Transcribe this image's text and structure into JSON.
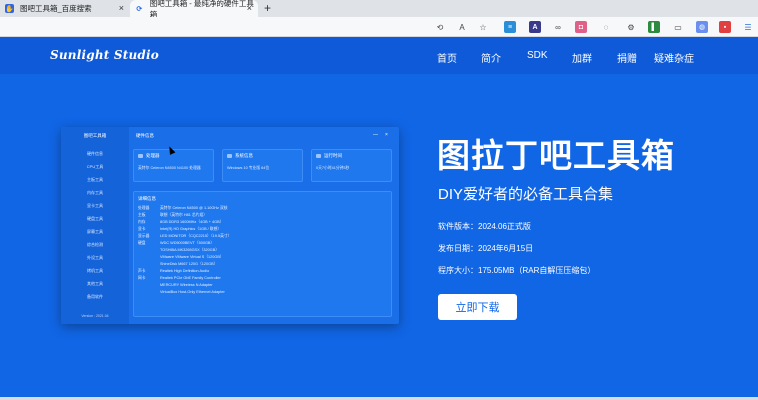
{
  "browser": {
    "tabs": [
      {
        "title": "图吧工具箱_百度搜索",
        "icon": "baidu-icon"
      },
      {
        "title": "图吧工具箱 - 最纯净的硬件工具箱",
        "icon": "site-icon"
      }
    ],
    "new_tab": "+",
    "close_glyph": "×"
  },
  "toolbar": {
    "icons": [
      "translate-icon",
      "read-aloud-icon",
      "favorite-icon",
      "extension-icon",
      "extension-icon",
      "link-icon",
      "extension-icon",
      "extension-icon",
      "extension-icon",
      "extension-icon",
      "extension-icon",
      "extension-icon",
      "extension-icon",
      "extension-icon"
    ],
    "ext_labels": {
      "A": "A",
      "ja": "あ",
      "inf": "∞"
    }
  },
  "site": {
    "logo": "Sunlight Studio",
    "nav": [
      "首页",
      "简介",
      "SDK",
      "加群",
      "捐赠",
      "疑难杂症"
    ],
    "hero_title": "图拉丁吧工具箱",
    "hero_subtitle": "DIY爱好者的必备工具合集",
    "version": "软件版本：2024.06正式版",
    "release": "发布日期：2024年6月15日",
    "size": "程序大小：175.05MB（RAR自解压压缩包）",
    "download": "立即下载"
  },
  "mockup": {
    "app_title": "图吧工具箱",
    "window_title": "硬件信息",
    "menu": [
      "硬件信息",
      "CPU工具",
      "主板工具",
      "内存工具",
      "显卡工具",
      "硬盘工具",
      "屏幕工具",
      "综合检测",
      "外设工具",
      "烤机工具",
      "其他工具",
      "备用软件"
    ],
    "version": "Version : 2021.04",
    "ctrl_min": "—",
    "ctrl_close": "×",
    "cards": [
      {
        "title": "处理器",
        "body": "英特尔 Celeron N4500 N4100 处理器"
      },
      {
        "title": "系统信息",
        "body": "Windows 10 专业版 64位"
      },
      {
        "title": "运行时间",
        "body": "0天7小时41分钟3秒"
      }
    ],
    "detail_title": "详细信息",
    "details": [
      {
        "label": "处理器",
        "value": "英特尔 Celeron N4500 @ 1.10GHz 双核"
      },
      {
        "label": "主板",
        "value": "联想（英特尔 H81 芯片组）"
      },
      {
        "label": "内存",
        "value": "8GB DDR3 1600MHz（4GB + 4GB）"
      },
      {
        "label": "显卡",
        "value": "Intel(R) HD Graphics（1GB / 联想）"
      },
      {
        "label": "显示器",
        "value": "LED MONITOR（CQC2215）（19.5英寸）"
      },
      {
        "label": "硬盘",
        "value": "WDC WD5000BEVT（500GB）"
      },
      {
        "label": "",
        "value": "TOSHIBA MK3265GSX（320GB）"
      },
      {
        "label": "",
        "value": "VMware VMware Virtual S（120GB）"
      },
      {
        "label": "",
        "value": "ShineDisk M667 120G（120GB）"
      },
      {
        "label": "声卡",
        "value": "Realtek High Definition Audio"
      },
      {
        "label": "网卡",
        "value": "Realtek PCIe GbE Family Controller"
      },
      {
        "label": "",
        "value": "MERCURY Wireless N Adapter"
      },
      {
        "label": "",
        "value": "VirtualBox Host-Only Ethernet Adapter"
      }
    ]
  },
  "colors": {
    "page_bg": "#1166e6",
    "navbar_bg": "#0e5ad8",
    "button_bg": "#ffffff",
    "button_text": "#1166e6"
  }
}
